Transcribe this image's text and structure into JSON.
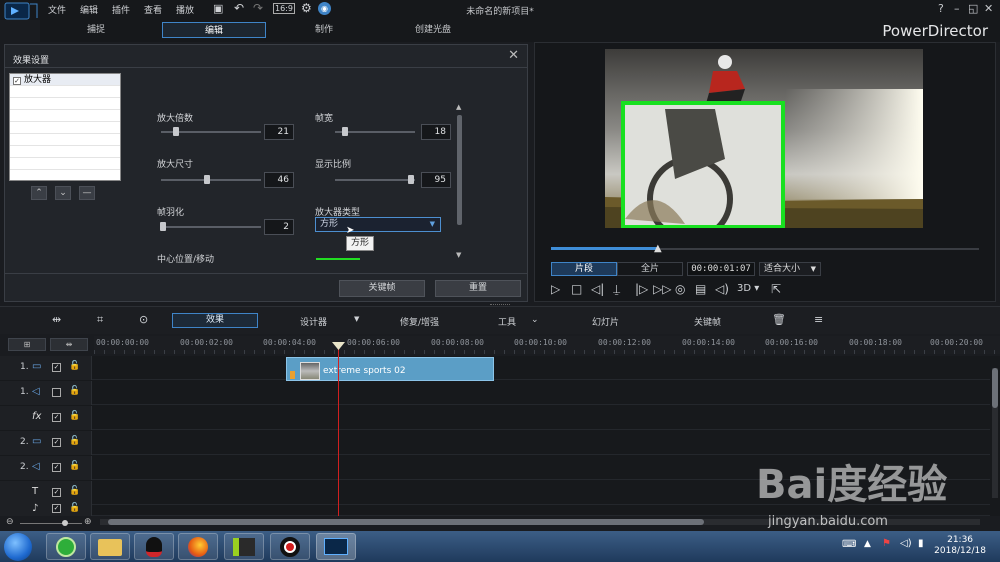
{
  "menu": [
    "文件",
    "编辑",
    "插件",
    "查看",
    "播放"
  ],
  "title": "未命名的新项目*",
  "brand": "PowerDirector",
  "tabs": [
    "捕捉",
    "编辑",
    "制作",
    "创建光盘"
  ],
  "window_controls": [
    "?",
    "–",
    "◱",
    "✕"
  ],
  "dialog": {
    "title": "效果设置",
    "effect_name": "放大器",
    "params": {
      "magnify_factor": {
        "label": "放大倍数",
        "value": "21",
        "level": 0.15
      },
      "frame_width": {
        "label": "帧宽",
        "value": "18",
        "level": 0.12
      },
      "magnify_size": {
        "label": "放大尺寸",
        "value": "46",
        "level": 0.46
      },
      "aspect": {
        "label": "显示比例",
        "value": "95",
        "level": 0.95
      },
      "feather": {
        "label": "帧羽化",
        "value": "2",
        "level": 0.02
      },
      "type": {
        "label": "放大器类型",
        "value": "方形",
        "tooltip": "方形"
      },
      "center": {
        "label": "中心位置/移动"
      }
    },
    "keyframe_button": "关键帧",
    "reset_button": "重置"
  },
  "preview": {
    "clip_button": "片段",
    "full_button": "全片",
    "timecode": "00:00:01:07",
    "fit": "适合大小",
    "label_3d": "3D",
    "progress": 0.25
  },
  "toolbar": {
    "effect": "效果",
    "designer": "设计器",
    "repair": "修复/增强",
    "tools": "工具",
    "slideshow": "幻灯片",
    "keyframe": "关键帧"
  },
  "ruler_ticks": [
    "00:00:00:00",
    "00:00:02:00",
    "00:00:04:00",
    "00:00:06:00",
    "00:00:08:00",
    "00:00:10:00",
    "00:00:12:00",
    "00:00:14:00",
    "00:00:16:00",
    "00:00:18:00",
    "00:00:20:00"
  ],
  "tracks": [
    {
      "num": "1.",
      "icon": "video-track-icon",
      "glyph": "▭",
      "checked": true
    },
    {
      "num": "1.",
      "icon": "audio-track-icon",
      "glyph": "◁",
      "checked": false
    },
    {
      "num": "",
      "icon": "fx-track-icon",
      "glyph": "fx",
      "checked": true
    },
    {
      "num": "2.",
      "icon": "video-track-icon",
      "glyph": "▭",
      "checked": true
    },
    {
      "num": "2.",
      "icon": "audio-track-icon",
      "glyph": "◁",
      "checked": true
    },
    {
      "num": "",
      "icon": "title-track-icon",
      "glyph": "T",
      "checked": true
    },
    {
      "num": "",
      "icon": "voice-track-icon",
      "glyph": "♪",
      "checked": true
    }
  ],
  "clip_label": "extreme sports 02",
  "clock": {
    "time": "21:36",
    "date": "2018/12/18"
  },
  "watermark": "Bai度经验",
  "watermark_url": "jingyan.baidu.com",
  "colors": {
    "accent": "#3f84c7",
    "magnifier_frame": "#18e020",
    "playhead": "#d02020",
    "clip": "#5b9ec6"
  }
}
